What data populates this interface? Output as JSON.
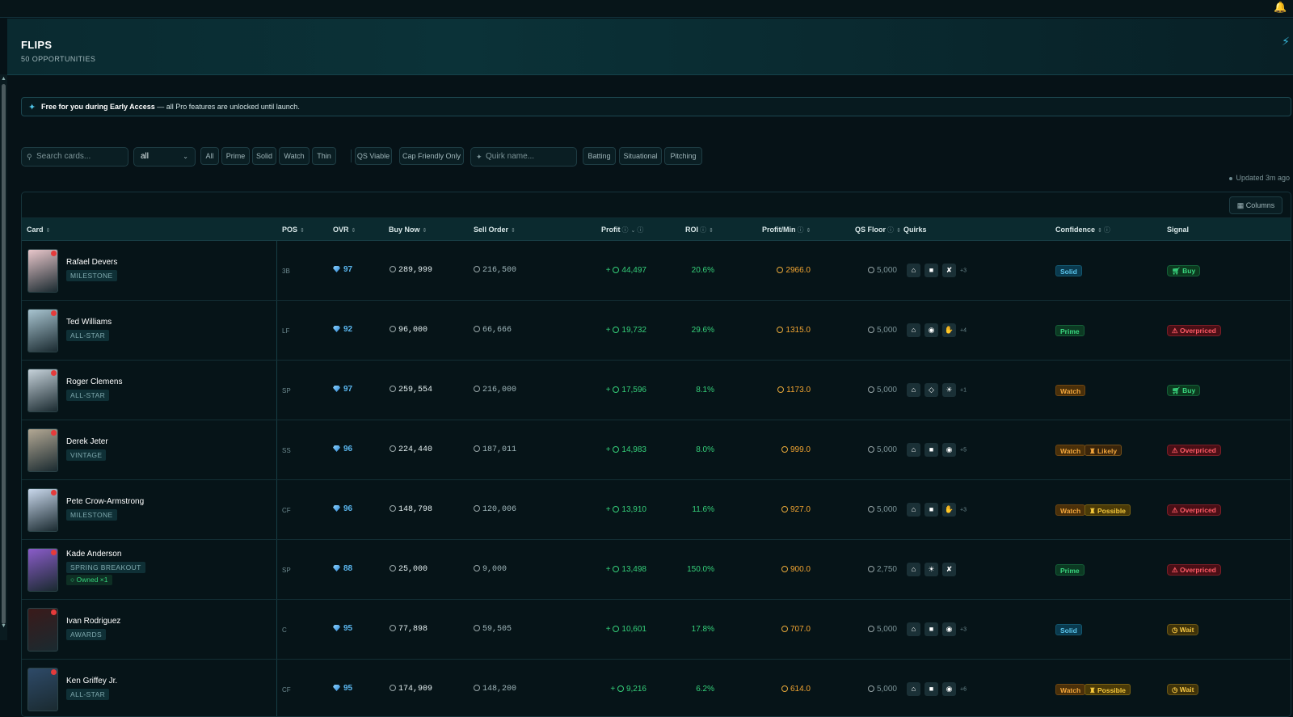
{
  "header": {
    "title": "FLIPS",
    "subtitle": "50 OPPORTUNITIES"
  },
  "banner": {
    "strong": "Free for you during Early Access",
    "rest": " — all Pro features are unlocked until launch."
  },
  "filters": {
    "search_placeholder": "Search cards...",
    "select_value": "all",
    "chips": [
      "All",
      "Prime",
      "Solid",
      "Watch",
      "Thin",
      "QS Viable",
      "Cap Friendly Only"
    ],
    "quirk_placeholder": "Quirk name...",
    "categories": [
      "Batting",
      "Situational",
      "Pitching"
    ]
  },
  "updated": "Updated 3m ago",
  "toolbar": {
    "columns": "Columns"
  },
  "columns": {
    "card": "Card",
    "pos": "POS",
    "ovr": "OVR",
    "buy": "Buy Now",
    "sell": "Sell Order",
    "profit": "Profit",
    "roi": "ROI",
    "pmin": "Profit/Min",
    "qs": "QS Floor",
    "quirks": "Quirks",
    "confidence": "Confidence",
    "signal": "Signal"
  },
  "colors": {
    "accent": "#38b6d8",
    "profit": "#35d07a",
    "warn": "#f3a531",
    "danger": "#ff5b66"
  },
  "rows": [
    {
      "name": "Rafael Devers",
      "series": "MILESTONE",
      "owned": "",
      "pos": "3B",
      "ovr": "97",
      "buy": "289,999",
      "sell": "216,500",
      "profit": "44,497",
      "roi": "20.6%",
      "pmin": "2966.0",
      "qs": "5,000",
      "quirks": [
        "home-icon",
        "tag-icon",
        "slash-icon"
      ],
      "more": "+3",
      "confidence": [
        "Solid"
      ],
      "signal": "Buy",
      "thumb": "#e9c7cb"
    },
    {
      "name": "Ted Williams",
      "series": "ALL-STAR",
      "owned": "",
      "pos": "LF",
      "ovr": "92",
      "buy": "96,000",
      "sell": "66,666",
      "profit": "19,732",
      "roi": "29.6%",
      "pmin": "1315.0",
      "qs": "5,000",
      "quirks": [
        "home-icon",
        "eye-icon",
        "glove-icon"
      ],
      "more": "+4",
      "confidence": [
        "Prime"
      ],
      "signal": "Overpriced",
      "thumb": "#a8c4d0"
    },
    {
      "name": "Roger Clemens",
      "series": "ALL-STAR",
      "owned": "",
      "pos": "SP",
      "ovr": "97",
      "buy": "259,554",
      "sell": "216,000",
      "profit": "17,596",
      "roi": "8.1%",
      "pmin": "1173.0",
      "qs": "5,000",
      "quirks": [
        "home-icon",
        "diamond-icon",
        "sun-icon"
      ],
      "more": "+1",
      "confidence": [
        "Watch"
      ],
      "signal": "Buy",
      "thumb": "#c6d2da"
    },
    {
      "name": "Derek Jeter",
      "series": "VINTAGE",
      "owned": "",
      "pos": "SS",
      "ovr": "96",
      "buy": "224,440",
      "sell": "187,011",
      "profit": "14,983",
      "roi": "8.0%",
      "pmin": "999.0",
      "qs": "5,000",
      "quirks": [
        "home-icon",
        "tag-icon",
        "eye-icon"
      ],
      "more": "+5",
      "confidence": [
        "Watch",
        "Likely"
      ],
      "signal": "Overpriced",
      "thumb": "#b3a894"
    },
    {
      "name": "Pete Crow-Armstrong",
      "series": "MILESTONE",
      "owned": "",
      "pos": "CF",
      "ovr": "96",
      "buy": "148,798",
      "sell": "120,006",
      "profit": "13,910",
      "roi": "11.6%",
      "pmin": "927.0",
      "qs": "5,000",
      "quirks": [
        "home-icon",
        "tag-icon",
        "glove-icon"
      ],
      "more": "+3",
      "confidence": [
        "Watch",
        "Possible"
      ],
      "signal": "Overpriced",
      "thumb": "#c9d8ec"
    },
    {
      "name": "Kade Anderson",
      "series": "SPRING BREAKOUT",
      "owned": "Owned ×1",
      "pos": "SP",
      "ovr": "88",
      "buy": "25,000",
      "sell": "9,000",
      "profit": "13,498",
      "roi": "150.0%",
      "pmin": "900.0",
      "qs": "2,750",
      "quirks": [
        "home-icon",
        "sun-icon",
        "slash-icon"
      ],
      "more": "",
      "confidence": [
        "Prime"
      ],
      "signal": "Overpriced",
      "thumb": "#8a5cc9"
    },
    {
      "name": "Ivan Rodriguez",
      "series": "AWARDS",
      "owned": "",
      "pos": "C",
      "ovr": "95",
      "buy": "77,898",
      "sell": "59,505",
      "profit": "10,601",
      "roi": "17.8%",
      "pmin": "707.0",
      "qs": "5,000",
      "quirks": [
        "home-icon",
        "tag-icon",
        "eye-icon"
      ],
      "more": "+3",
      "confidence": [
        "Solid"
      ],
      "signal": "Wait",
      "thumb": "#3a1a1a"
    },
    {
      "name": "Ken Griffey Jr.",
      "series": "ALL-STAR",
      "owned": "",
      "pos": "CF",
      "ovr": "95",
      "buy": "174,909",
      "sell": "148,200",
      "profit": "9,216",
      "roi": "6.2%",
      "pmin": "614.0",
      "qs": "5,000",
      "quirks": [
        "home-icon",
        "tag-icon",
        "eye-icon"
      ],
      "more": "+6",
      "confidence": [
        "Watch",
        "Possible"
      ],
      "signal": "Wait",
      "thumb": "#2e4a68"
    }
  ]
}
